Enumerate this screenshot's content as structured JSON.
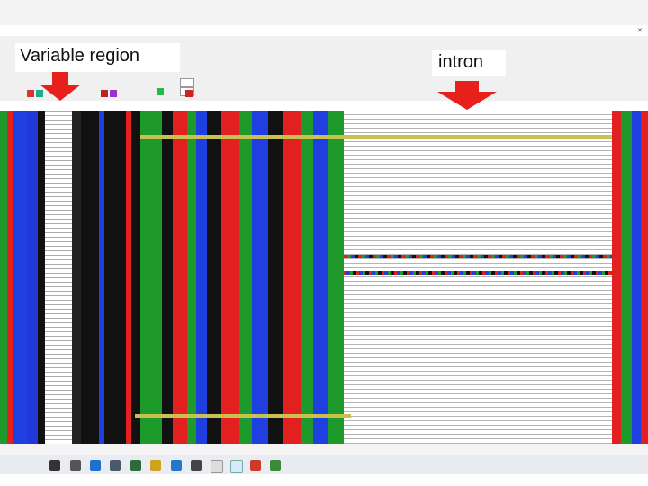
{
  "annotations": {
    "variable_region_label": "Variable region",
    "intron_label": "intron"
  },
  "colors": {
    "arrow_red": "#e8201c",
    "nucleotide_a": "#1e9a2a",
    "nucleotide_c": "#1f3fe0",
    "nucleotide_g": "#111111",
    "nucleotide_t": "#e22020",
    "highlight": "#c8c050"
  },
  "icons": [
    "window-minimize-icon",
    "window-close-icon",
    "toolbar-icon",
    "taskbar-app-icon"
  ]
}
